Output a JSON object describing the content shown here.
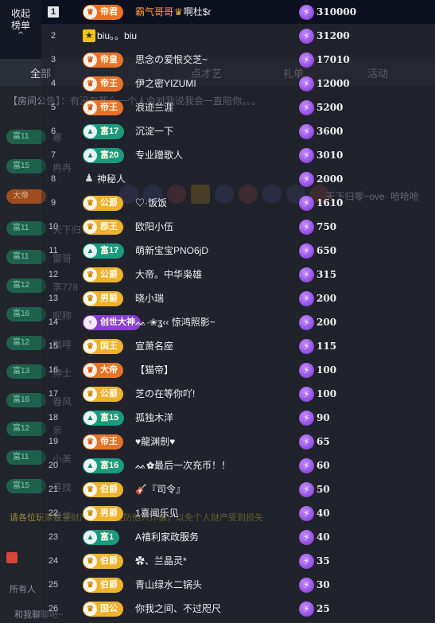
{
  "collapse": {
    "label": "收起榜单",
    "chevron": "^"
  },
  "background": {
    "tabs": [
      "全部",
      "点才艺",
      "礼单",
      "活动"
    ],
    "announcement": "【房间公告】：",
    "announcement_text": "有没有那么一个人会对我说我会一直陪你。。。",
    "badges": [
      {
        "text": "富11",
        "style": "teal"
      },
      {
        "text": "富15",
        "style": "teal"
      },
      {
        "text": "大帝",
        "style": "orange"
      },
      {
        "text": "富11",
        "style": "teal"
      },
      {
        "text": "富11",
        "style": "teal"
      },
      {
        "text": "富12",
        "style": "teal"
      },
      {
        "text": "富16",
        "style": "teal"
      },
      {
        "text": "富12",
        "style": "teal"
      },
      {
        "text": "富13",
        "style": "teal"
      },
      {
        "text": "富16",
        "style": "teal"
      },
      {
        "text": "富12",
        "style": "teal"
      },
      {
        "text": "富11",
        "style": "teal"
      },
      {
        "text": "富15",
        "style": "teal"
      }
    ],
    "chat_lines": [
      "寒",
      "冉冉",
      "天下归零",
      "雷哥",
      "李778",
      "昵称",
      "咖啡",
      "绅士",
      "春风",
      "亲",
      "小美",
      "寻找",
      "奢华"
    ],
    "right_text": "天下归零~ove· 哈哈哈",
    "warning": "请各位玩家注意财产安全，谨防他人诈骗，以免个人财产受到损失",
    "bottom_label_1": "所有人",
    "bottom_label_2": "和我聊聊吧~"
  },
  "leaderboard": [
    {
      "rank": "1",
      "badge": "帝君",
      "badge_style": "orange",
      "name": "霸气哥哥",
      "name_style": "orange",
      "crown": true,
      "name_suffix": "啊杜$r",
      "value": "310000"
    },
    {
      "rank": "2",
      "badge": "",
      "avatar": "biu",
      "name": "biu。。biu",
      "value": "31200"
    },
    {
      "rank": "3",
      "badge": "帝皇",
      "badge_style": "orange",
      "name": "思念の爱恨交芝~",
      "value": "17010"
    },
    {
      "rank": "4",
      "badge": "帝王",
      "badge_style": "orange",
      "name": "伊之密YIZUMI",
      "value": "12000"
    },
    {
      "rank": "5",
      "badge": "帝王",
      "badge_style": "orange",
      "name": "浪迹兰涯",
      "value": "5200"
    },
    {
      "rank": "6",
      "badge": "富17",
      "badge_style": "teal",
      "name": "沉淀一下",
      "value": "3600"
    },
    {
      "rank": "7",
      "badge": "富20",
      "badge_style": "teal",
      "name": "专业蹭歌人",
      "value": "3010"
    },
    {
      "rank": "8",
      "badge": "",
      "avatar": "mys",
      "name": "神秘人",
      "value": "2000"
    },
    {
      "rank": "9",
      "badge": "公爵",
      "badge_style": "gold",
      "name": "♡·饭饭",
      "value": "1610"
    },
    {
      "rank": "10",
      "badge": "郡王",
      "badge_style": "gold",
      "name": "欧阳小伍",
      "value": "750"
    },
    {
      "rank": "11",
      "badge": "富17",
      "badge_style": "teal",
      "name": "萌新宝宝PNO6jD",
      "value": "650"
    },
    {
      "rank": "12",
      "badge": "公爵",
      "badge_style": "gold",
      "name": "大帝。中华枭雄",
      "value": "315"
    },
    {
      "rank": "13",
      "badge": "男爵",
      "badge_style": "gold",
      "name": "晓小瑞",
      "value": "200"
    },
    {
      "rank": "14",
      "badge": "创世大神",
      "badge_style": "purple",
      "name": "ᨐ·❀ʓ‹‹ 惊鸿照影~",
      "value": "200"
    },
    {
      "rank": "15",
      "badge": "国王",
      "badge_style": "gold",
      "name": "宣萧名座",
      "value": "115"
    },
    {
      "rank": "16",
      "badge": "大帝",
      "badge_style": "orange",
      "name": "【猫帝】",
      "value": "100"
    },
    {
      "rank": "17",
      "badge": "公爵",
      "badge_style": "gold",
      "name": "芝の在等你吖!",
      "value": "100"
    },
    {
      "rank": "18",
      "badge": "富15",
      "badge_style": "teal",
      "name": "孤独木洋",
      "value": "90"
    },
    {
      "rank": "19",
      "badge": "帝王",
      "badge_style": "orange",
      "name": "♥龍渊劍♥",
      "value": "65"
    },
    {
      "rank": "20",
      "badge": "富16",
      "badge_style": "teal",
      "name": "ᨐ✿最后一次充币！！",
      "value": "60"
    },
    {
      "rank": "21",
      "badge": "伯爵",
      "badge_style": "gold",
      "name": "🎸『司令』",
      "value": "50"
    },
    {
      "rank": "22",
      "badge": "男爵",
      "badge_style": "gold",
      "name": "1喜闻乐见",
      "value": "40"
    },
    {
      "rank": "23",
      "badge": "富1",
      "badge_style": "teal",
      "name": "A禧利家政服务",
      "value": "40"
    },
    {
      "rank": "24",
      "badge": "伯爵",
      "badge_style": "gold",
      "name": "✿、兰晶灵*",
      "value": "35"
    },
    {
      "rank": "25",
      "badge": "伯爵",
      "badge_style": "gold",
      "name": "青山绿水二锅头",
      "value": "30"
    },
    {
      "rank": "26",
      "badge": "国公",
      "badge_style": "gold",
      "name": "你我之间、不过咫尺",
      "value": "25"
    }
  ]
}
